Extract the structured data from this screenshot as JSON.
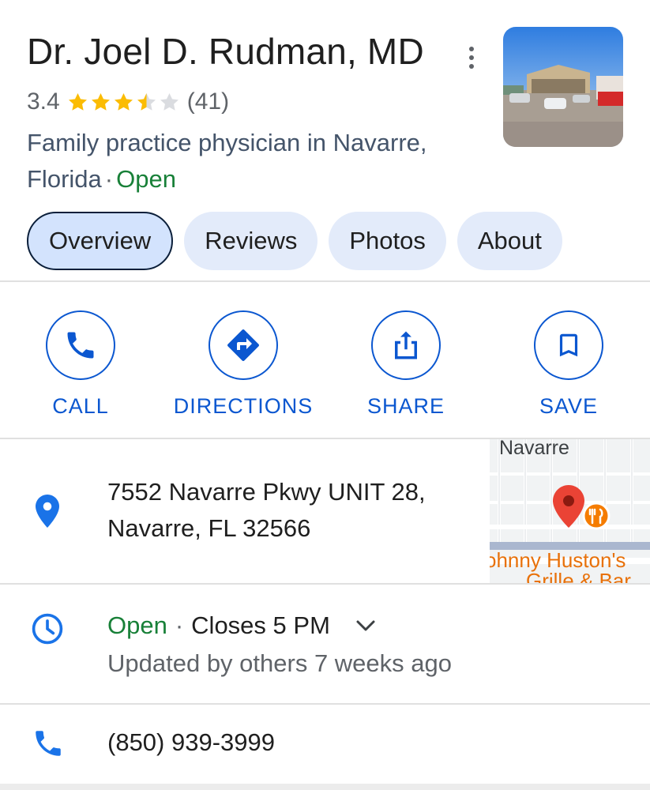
{
  "place": {
    "name": "Dr. Joel D. Rudman, MD",
    "rating": "3.4",
    "rating_value": 3.4,
    "review_count": "(41)",
    "category_text": "Family practice physician in Navarre, Florida",
    "separator": "·",
    "status": "Open"
  },
  "tabs": [
    {
      "label": "Overview",
      "active": true
    },
    {
      "label": "Reviews",
      "active": false
    },
    {
      "label": "Photos",
      "active": false
    },
    {
      "label": "About",
      "active": false
    }
  ],
  "actions": [
    {
      "label": "CALL",
      "icon": "phone-icon"
    },
    {
      "label": "DIRECTIONS",
      "icon": "directions-icon"
    },
    {
      "label": "SHARE",
      "icon": "share-icon"
    },
    {
      "label": "SAVE",
      "icon": "bookmark-icon"
    }
  ],
  "address": {
    "line1": "7552 Navarre Pkwy UNIT 28,",
    "line2": "Navarre, FL 32566",
    "icon": "location-pin-icon"
  },
  "map": {
    "town_label": "Navarre",
    "poi_label_line1": "ohnny Huston's",
    "poi_label_line2": "Grille & Bar"
  },
  "hours": {
    "status": "Open",
    "separator": "·",
    "closes": "Closes 5 PM",
    "updated": "Updated by others 7 weeks ago",
    "icon": "clock-icon"
  },
  "phone": {
    "number": "(850) 939-3999",
    "icon": "phone-icon"
  },
  "colors": {
    "accent": "#0b57d0",
    "open_green": "#188038",
    "star": "#fbbc04",
    "tab_bg": "#e3ebfa"
  }
}
